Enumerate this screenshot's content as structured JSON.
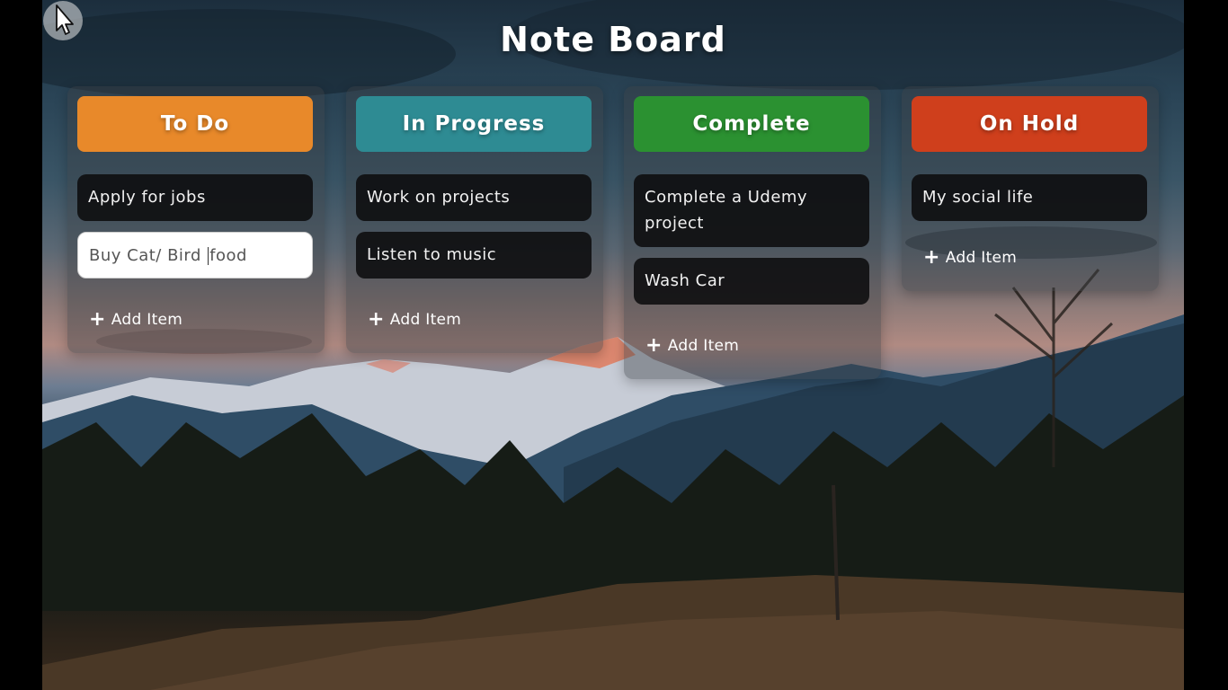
{
  "app": {
    "title": "Note Board"
  },
  "columns": [
    {
      "title": "To Do",
      "color": "#e8892a",
      "items": [
        "Apply for jobs"
      ],
      "editing_before": "Buy Cat/ Bird ",
      "editing_after": "food",
      "add_label": "Add Item"
    },
    {
      "title": "In Progress",
      "color": "#2e8b93",
      "items": [
        "Work on projects",
        "Listen to music"
      ],
      "add_label": "Add Item"
    },
    {
      "title": "Complete",
      "color": "#2b9131",
      "items": [
        "Complete a Udemy project",
        "Wash Car"
      ],
      "add_label": "Add Item"
    },
    {
      "title": "On Hold",
      "color": "#cf3f1c",
      "items": [
        "My social life"
      ],
      "add_label": "Add Item"
    }
  ],
  "icons": {
    "add": "plus-icon",
    "pointer": "mouse-pointer-icon"
  }
}
